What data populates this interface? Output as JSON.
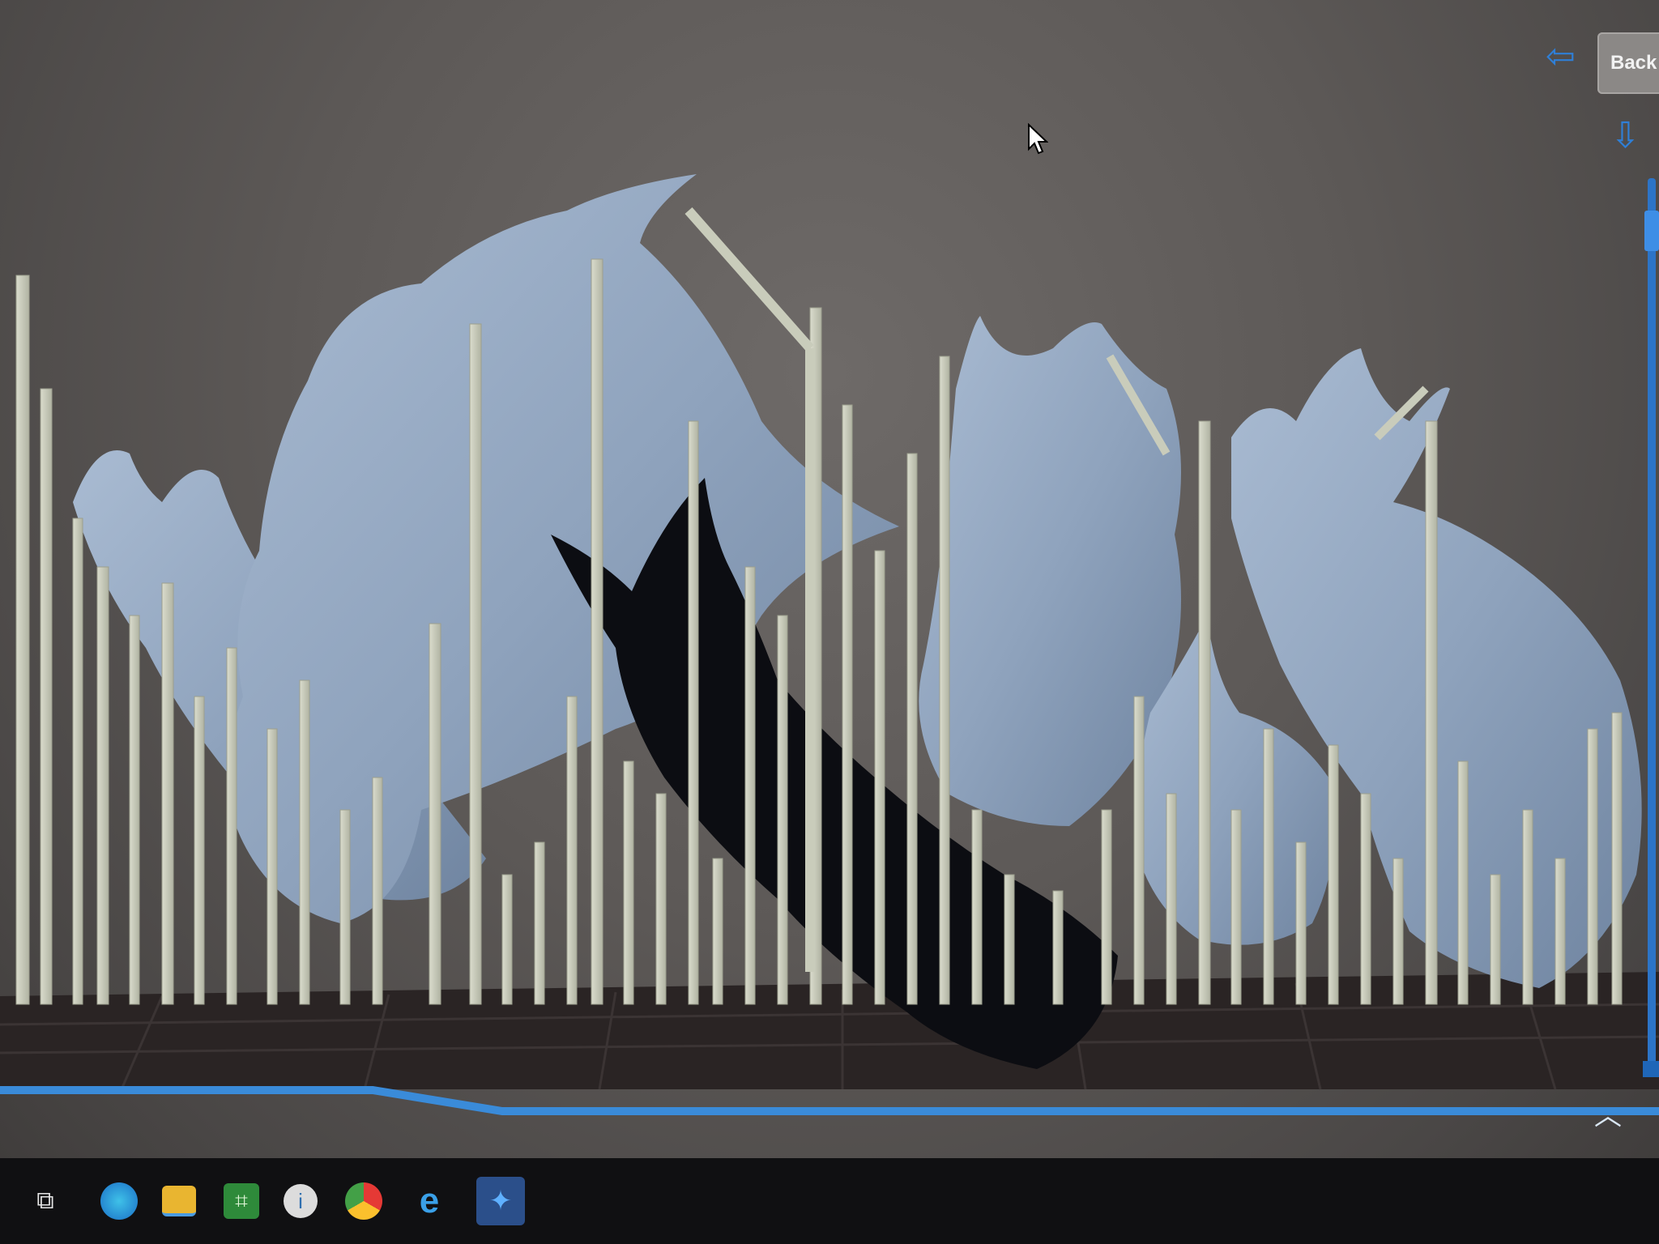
{
  "window": {
    "back_label": "Back"
  },
  "toolbar": {
    "nav_left_icon": "left-arrow-icon",
    "nav_down_icon": "down-arrow-icon",
    "collapse_icon": "chevron-up-icon"
  },
  "taskbar": {
    "icons": [
      "task-view-icon",
      "edge-icon",
      "file-explorer-icon",
      "green-app-icon",
      "info-app-icon",
      "chrome-icon",
      "internet-explorer-icon",
      "slicer-app-icon"
    ]
  },
  "colors": {
    "model": "#8fa3bd",
    "support": "#c9ccbb",
    "accent": "#2f7fd6",
    "plate_grid": "#1e1b1b"
  }
}
